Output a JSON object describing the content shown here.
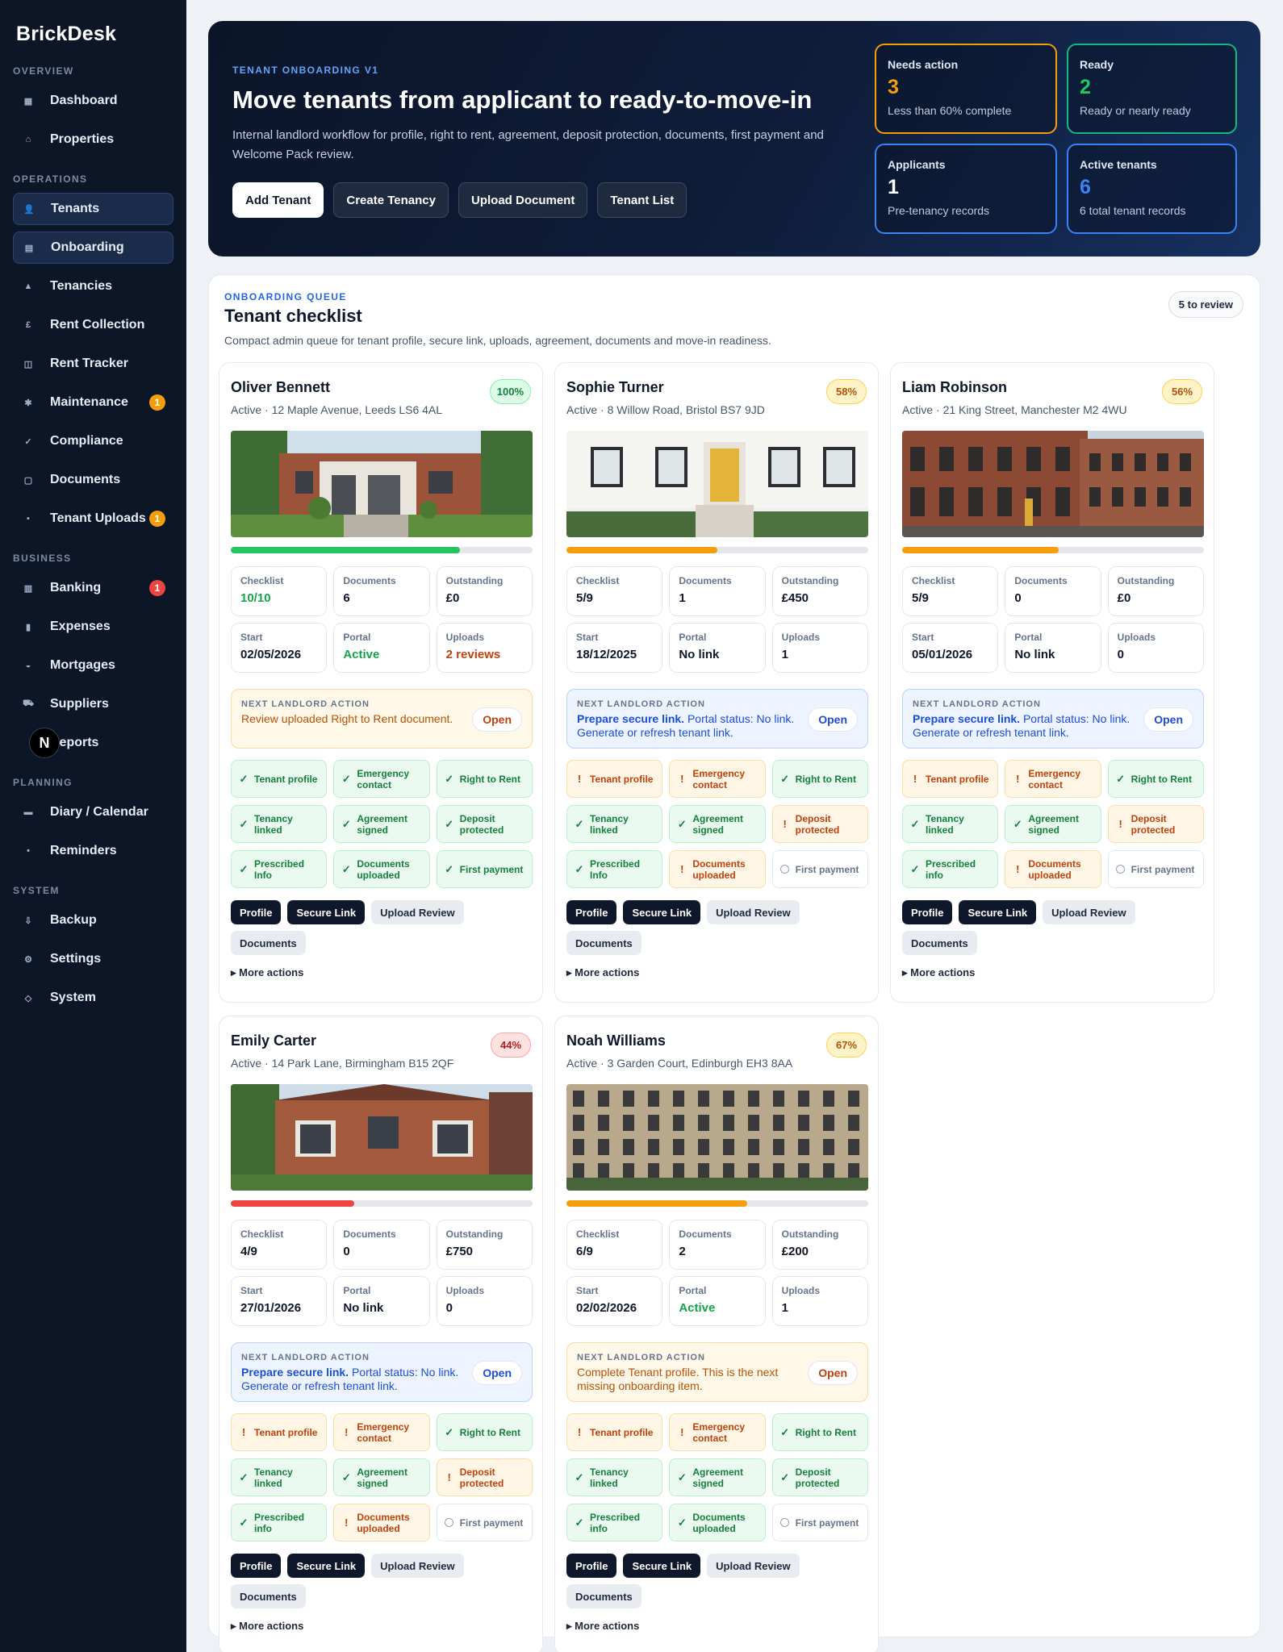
{
  "brand": "BrickDesk",
  "sidebar": {
    "sections": [
      {
        "title": "OVERVIEW",
        "items": [
          {
            "label": "Dashboard",
            "icon": "dashboard-icon"
          },
          {
            "label": "Properties",
            "icon": "home-icon"
          }
        ]
      },
      {
        "title": "OPERATIONS",
        "items": [
          {
            "label": "Tenants",
            "icon": "user-icon",
            "active": true
          },
          {
            "label": "Onboarding",
            "icon": "clipboard-icon",
            "active": true
          },
          {
            "label": "Tenancies",
            "icon": "key-icon"
          },
          {
            "label": "Rent Collection",
            "icon": "pound-icon"
          },
          {
            "label": "Rent Tracker",
            "icon": "tracker-icon"
          },
          {
            "label": "Maintenance",
            "icon": "wrench-icon",
            "badge": "1",
            "badge_color": "orange"
          },
          {
            "label": "Compliance",
            "icon": "check-icon"
          },
          {
            "label": "Documents",
            "icon": "document-icon"
          },
          {
            "label": "Tenant Uploads",
            "icon": "upload-icon",
            "badge": "1",
            "badge_color": "orange"
          }
        ]
      },
      {
        "title": "BUSINESS",
        "items": [
          {
            "label": "Banking",
            "icon": "bank-icon",
            "badge": "1",
            "badge_color": "red"
          },
          {
            "label": "Expenses",
            "icon": "receipt-icon"
          },
          {
            "label": "Mortgages",
            "icon": "mortgage-icon"
          },
          {
            "label": "Suppliers",
            "icon": "suppliers-icon"
          },
          {
            "label": "Reports",
            "icon": "reports-icon",
            "avatar": "N"
          }
        ]
      },
      {
        "title": "PLANNING",
        "items": [
          {
            "label": "Diary / Calendar",
            "icon": "calendar-icon"
          },
          {
            "label": "Reminders",
            "icon": "bell-icon"
          }
        ]
      },
      {
        "title": "SYSTEM",
        "items": [
          {
            "label": "Backup",
            "icon": "backup-icon"
          },
          {
            "label": "Settings",
            "icon": "gear-icon"
          },
          {
            "label": "System",
            "icon": "system-icon"
          }
        ]
      }
    ]
  },
  "hero": {
    "eyebrow": "TENANT ONBOARDING V1",
    "title": "Move tenants from applicant to ready-to-move-in",
    "description": "Internal landlord workflow for profile, right to rent, agreement, deposit protection, documents, first payment and Welcome Pack review.",
    "buttons": [
      "Add Tenant",
      "Create Tenancy",
      "Upload Document",
      "Tenant List"
    ],
    "stats": [
      {
        "label": "Needs action",
        "value": "3",
        "sub": "Less than 60% complete",
        "color": "#f59e0b"
      },
      {
        "label": "Ready",
        "value": "2",
        "sub": "Ready or nearly ready",
        "color": "#22c55e"
      },
      {
        "label": "Applicants",
        "value": "1",
        "sub": "Pre-tenancy records",
        "color": "#ffffff"
      },
      {
        "label": "Active tenants",
        "value": "6",
        "sub": "6 total tenant records",
        "color": "#3b82f6"
      }
    ]
  },
  "queue": {
    "eyebrow": "ONBOARDING QUEUE",
    "title": "Tenant checklist",
    "description": "Compact admin queue for tenant profile, secure link, uploads, agreement, documents and move-in readiness.",
    "review_pill": "5 to review",
    "action_label": "NEXT LANDLORD ACTION",
    "open_label": "Open",
    "buttons": [
      "Profile",
      "Secure Link",
      "Upload Review",
      "Documents"
    ],
    "more_actions": "More actions",
    "metric_labels": [
      "Checklist",
      "Documents",
      "Outstanding",
      "Start",
      "Portal",
      "Uploads"
    ]
  },
  "tenants": [
    {
      "name": "Oliver Bennett",
      "status": "Active",
      "address": "12 Maple Avenue, Leeds LS6 4AL",
      "percent": "100%",
      "percent_tone": "green",
      "progress": 0.76,
      "progress_color": "#22c55e",
      "photo": "modern",
      "metrics": [
        {
          "value": "10/10",
          "tone": "green"
        },
        {
          "value": "6",
          "tone": ""
        },
        {
          "value": "£0",
          "tone": ""
        },
        {
          "value": "02/05/2026",
          "tone": ""
        },
        {
          "value": "Active",
          "tone": "green"
        },
        {
          "value": "2 reviews",
          "tone": "orange"
        }
      ],
      "action": {
        "tone": "amber",
        "bold": "",
        "text": "Review uploaded Right to Rent document."
      },
      "checks": [
        {
          "label": "Tenant profile",
          "state": "ok"
        },
        {
          "label": "Emergency contact",
          "state": "ok"
        },
        {
          "label": "Right to Rent",
          "state": "ok"
        },
        {
          "label": "Tenancy linked",
          "state": "ok"
        },
        {
          "label": "Agreement signed",
          "state": "ok"
        },
        {
          "label": "Deposit protected",
          "state": "ok"
        },
        {
          "label": "Prescribed Info",
          "state": "ok"
        },
        {
          "label": "Documents uploaded",
          "state": "ok"
        },
        {
          "label": "First payment",
          "state": "ok"
        }
      ]
    },
    {
      "name": "Sophie Turner",
      "status": "Active",
      "address": "8 Willow Road, Bristol BS7 9JD",
      "percent": "58%",
      "percent_tone": "amber",
      "progress": 0.5,
      "progress_color": "#f59e0b",
      "photo": "white",
      "metrics": [
        {
          "value": "5/9",
          "tone": ""
        },
        {
          "value": "1",
          "tone": ""
        },
        {
          "value": "£450",
          "tone": ""
        },
        {
          "value": "18/12/2025",
          "tone": ""
        },
        {
          "value": "No link",
          "tone": ""
        },
        {
          "value": "1",
          "tone": ""
        }
      ],
      "action": {
        "tone": "blue",
        "bold": "Prepare secure link.",
        "text": "Portal status: No link. Generate or refresh tenant link."
      },
      "checks": [
        {
          "label": "Tenant profile",
          "state": "warn"
        },
        {
          "label": "Emergency contact",
          "state": "warn"
        },
        {
          "label": "Right to Rent",
          "state": "ok"
        },
        {
          "label": "Tenancy linked",
          "state": "ok"
        },
        {
          "label": "Agreement signed",
          "state": "ok"
        },
        {
          "label": "Deposit protected",
          "state": "warn"
        },
        {
          "label": "Prescribed Info",
          "state": "ok"
        },
        {
          "label": "Documents uploaded",
          "state": "warn"
        },
        {
          "label": "First payment",
          "state": "none"
        }
      ]
    },
    {
      "name": "Liam Robinson",
      "status": "Active",
      "address": "21 King Street, Manchester M2 4WU",
      "percent": "56%",
      "percent_tone": "amber",
      "progress": 0.52,
      "progress_color": "#f59e0b",
      "photo": "terrace",
      "metrics": [
        {
          "value": "5/9",
          "tone": ""
        },
        {
          "value": "0",
          "tone": ""
        },
        {
          "value": "£0",
          "tone": ""
        },
        {
          "value": "05/01/2026",
          "tone": ""
        },
        {
          "value": "No link",
          "tone": ""
        },
        {
          "value": "0",
          "tone": ""
        }
      ],
      "action": {
        "tone": "blue",
        "bold": "Prepare secure link.",
        "text": "Portal status: No link. Generate or refresh tenant link."
      },
      "checks": [
        {
          "label": "Tenant profile",
          "state": "warn"
        },
        {
          "label": "Emergency contact",
          "state": "warn"
        },
        {
          "label": "Right to Rent",
          "state": "ok"
        },
        {
          "label": "Tenancy linked",
          "state": "ok"
        },
        {
          "label": "Agreement signed",
          "state": "ok"
        },
        {
          "label": "Deposit protected",
          "state": "warn"
        },
        {
          "label": "Prescribed info",
          "state": "ok"
        },
        {
          "label": "Documents uploaded",
          "state": "warn"
        },
        {
          "label": "First payment",
          "state": "none"
        }
      ]
    },
    {
      "name": "Emily Carter",
      "status": "Active",
      "address": "14 Park Lane, Birmingham B15 2QF",
      "percent": "44%",
      "percent_tone": "red",
      "progress": 0.41,
      "progress_color": "#ef4444",
      "photo": "victorian",
      "metrics": [
        {
          "value": "4/9",
          "tone": ""
        },
        {
          "value": "0",
          "tone": ""
        },
        {
          "value": "£750",
          "tone": ""
        },
        {
          "value": "27/01/2026",
          "tone": ""
        },
        {
          "value": "No link",
          "tone": ""
        },
        {
          "value": "0",
          "tone": ""
        }
      ],
      "action": {
        "tone": "blue",
        "bold": "Prepare secure link.",
        "text": "Portal status: No link. Generate or refresh tenant link."
      },
      "checks": [
        {
          "label": "Tenant profile",
          "state": "warn"
        },
        {
          "label": "Emergency contact",
          "state": "warn"
        },
        {
          "label": "Right to Rent",
          "state": "ok"
        },
        {
          "label": "Tenancy linked",
          "state": "ok"
        },
        {
          "label": "Agreement signed",
          "state": "ok"
        },
        {
          "label": "Deposit protected",
          "state": "warn"
        },
        {
          "label": "Prescribed info",
          "state": "ok"
        },
        {
          "label": "Documents uploaded",
          "state": "warn"
        },
        {
          "label": "First payment",
          "state": "none"
        }
      ]
    },
    {
      "name": "Noah Williams",
      "status": "Active",
      "address": "3 Garden Court, Edinburgh EH3 8AA",
      "percent": "67%",
      "percent_tone": "amber",
      "progress": 0.6,
      "progress_color": "#f59e0b",
      "photo": "stone",
      "metrics": [
        {
          "value": "6/9",
          "tone": ""
        },
        {
          "value": "2",
          "tone": ""
        },
        {
          "value": "£200",
          "tone": ""
        },
        {
          "value": "02/02/2026",
          "tone": ""
        },
        {
          "value": "Active",
          "tone": "green"
        },
        {
          "value": "1",
          "tone": ""
        }
      ],
      "action": {
        "tone": "amber",
        "bold": "",
        "text": "Complete Tenant profile. This is the next missing onboarding item."
      },
      "checks": [
        {
          "label": "Tenant profile",
          "state": "warn"
        },
        {
          "label": "Emergency contact",
          "state": "warn"
        },
        {
          "label": "Right to Rent",
          "state": "ok"
        },
        {
          "label": "Tenancy linked",
          "state": "ok"
        },
        {
          "label": "Agreement signed",
          "state": "ok"
        },
        {
          "label": "Deposit protected",
          "state": "ok"
        },
        {
          "label": "Prescribed info",
          "state": "ok"
        },
        {
          "label": "Documents uploaded",
          "state": "ok"
        },
        {
          "label": "First payment",
          "state": "none"
        }
      ]
    }
  ]
}
